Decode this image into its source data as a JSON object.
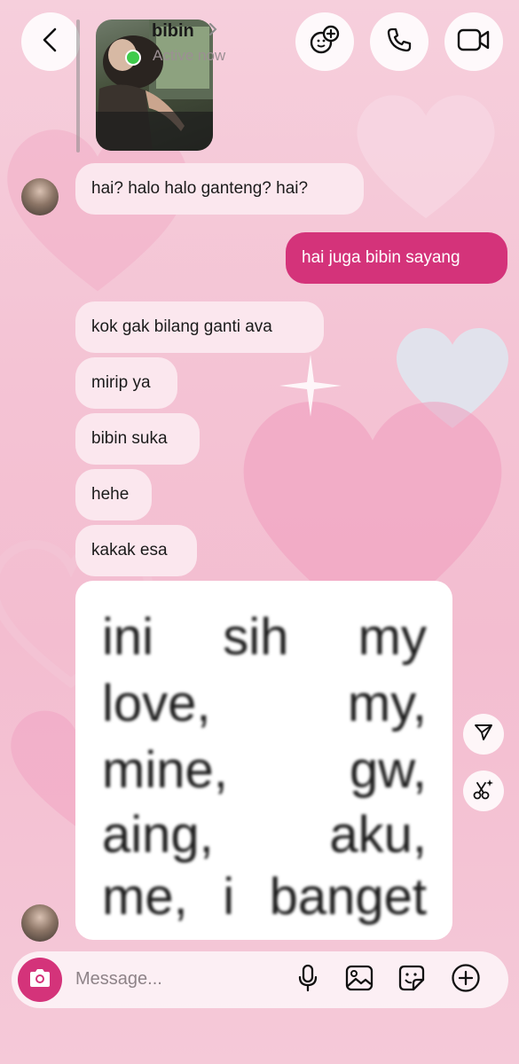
{
  "header": {
    "back_icon": "chevron-left-icon",
    "contact_name": "bibin",
    "status": "Active now",
    "actions": [
      "effects-icon",
      "phone-icon",
      "video-icon"
    ]
  },
  "messages": [
    {
      "from": "them",
      "text": "hai? halo halo ganteng? hai?"
    },
    {
      "from": "me",
      "text": "hai juga bibin sayang"
    },
    {
      "from": "them",
      "text": "kok gak bilang ganti ava"
    },
    {
      "from": "them",
      "text": "mirip ya"
    },
    {
      "from": "them",
      "text": "bibin suka"
    },
    {
      "from": "them",
      "text": "hehe"
    },
    {
      "from": "them",
      "text": "kakak esa"
    }
  ],
  "image_message": {
    "lines": [
      [
        "ini",
        "sih",
        "my"
      ],
      [
        "love,",
        "my,"
      ],
      [
        "mine,",
        "gw,"
      ],
      [
        "aing,",
        "aku,"
      ],
      [
        "me,",
        "i",
        "banget"
      ]
    ]
  },
  "image_actions": [
    "share-icon",
    "ai-edit-icon"
  ],
  "composer": {
    "placeholder": "Message...",
    "icons": [
      "camera-icon",
      "microphone-icon",
      "gallery-icon",
      "sticker-icon",
      "plus-icon"
    ]
  },
  "colors": {
    "accent": "#d4337a",
    "bubble_them": "#fbe7ee",
    "online": "#3ecb4b"
  }
}
